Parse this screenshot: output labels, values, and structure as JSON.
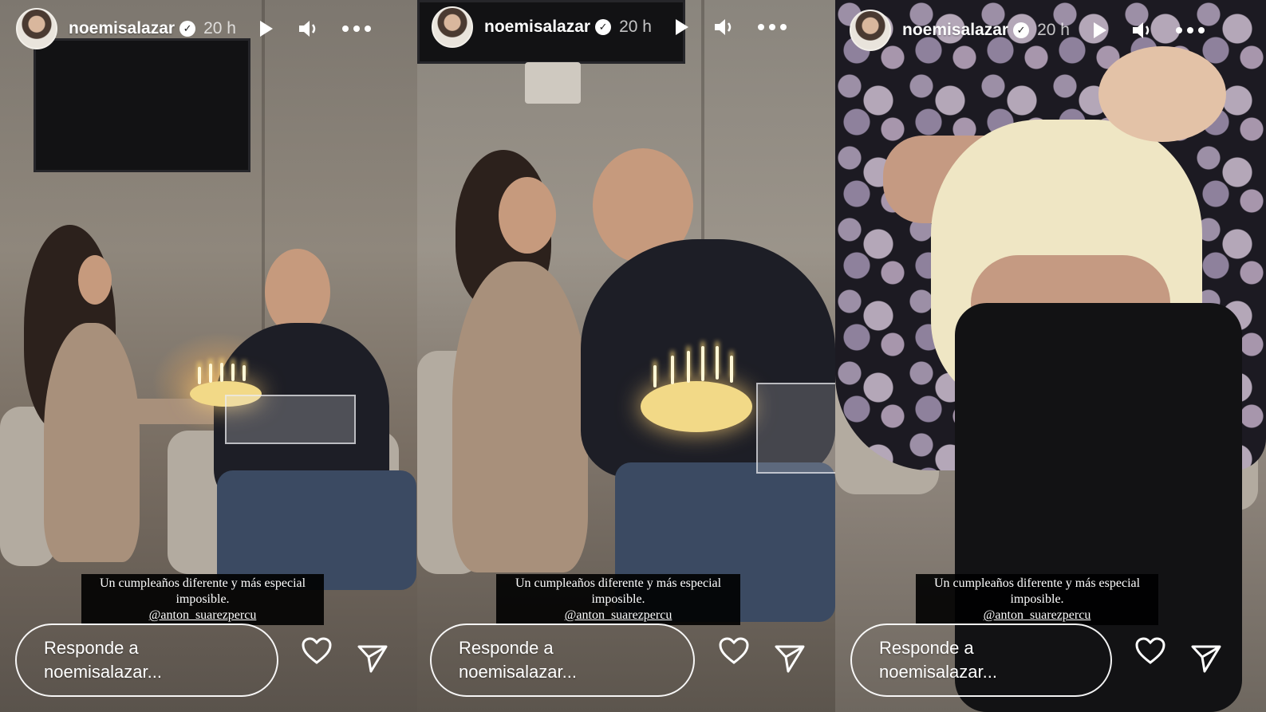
{
  "story": {
    "username": "noemisalazar",
    "verified_mark": "✓",
    "time_ago": "20 h",
    "caption_line1": "Un cumpleaños diferente y más especial",
    "caption_line2": "imposible.",
    "caption_mention": "@anton_suarezpercu",
    "reply_placeholder_line1": "Responde a",
    "reply_placeholder_line2": "noemisalazar...",
    "icons": {
      "play": "play-icon",
      "volume": "volume-icon",
      "more": "more-icon",
      "like": "heart-icon",
      "share": "send-icon"
    }
  },
  "panels": [
    {
      "scene": "girl-handing-cake-to-man"
    },
    {
      "scene": "girl-and-man-with-cake"
    },
    {
      "scene": "holding-newborn"
    }
  ]
}
